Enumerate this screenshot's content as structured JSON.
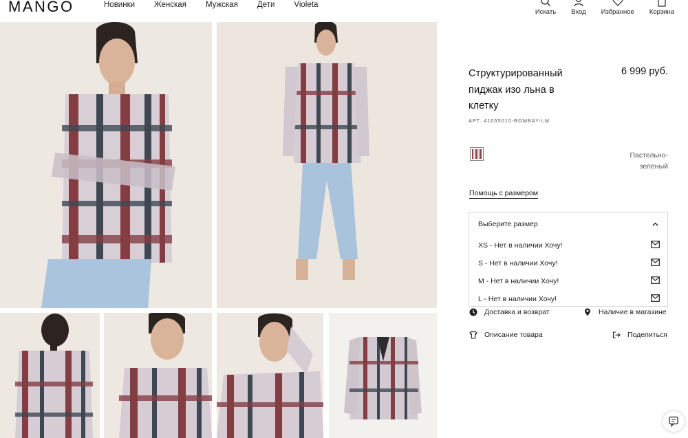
{
  "brand": "MANGO",
  "nav": [
    "Новинки",
    "Женская",
    "Мужская",
    "Дети",
    "Violeta"
  ],
  "header_actions": [
    {
      "label": "Искать",
      "icon": "search-icon"
    },
    {
      "label": "Вход",
      "icon": "user-icon"
    },
    {
      "label": "Избранное",
      "icon": "heart-icon"
    },
    {
      "label": "Корзина",
      "icon": "bag-icon"
    }
  ],
  "product": {
    "title": "Структурированный пиджак изо льна в клетку",
    "price": "6 999 руб.",
    "article": "АРТ. 41055010-BOMBAY-LM",
    "color": "Пастельно-зеленый",
    "size_help": "Помощь с размером"
  },
  "size_select": {
    "header": "Выберите размер",
    "options": [
      "XS - Нет в наличии Хочу!",
      "S - Нет в наличии Хочу!",
      "M - Нет в наличии Хочу!",
      "L - Нет в наличии Хочу!"
    ]
  },
  "services": {
    "delivery": "Доставка и возврат",
    "store": "Наличие в магазине",
    "description": "Описание товара",
    "share": "Поделиться"
  },
  "gallery": [
    {
      "name": "product-photo-crossed-arms"
    },
    {
      "name": "product-photo-full-length"
    },
    {
      "name": "product-photo-back"
    },
    {
      "name": "product-photo-closeup"
    },
    {
      "name": "product-photo-hand-on-head"
    },
    {
      "name": "product-photo-flatlay"
    }
  ]
}
